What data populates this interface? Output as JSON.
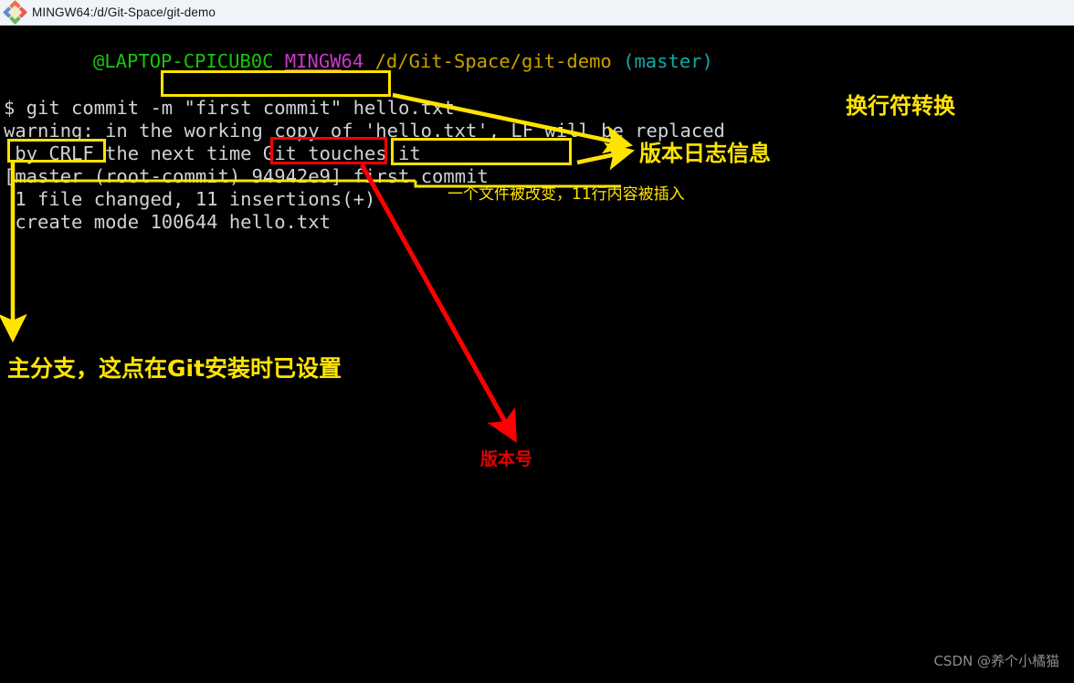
{
  "window": {
    "title": "MINGW64:/d/Git-Space/git-demo",
    "icon": "mingw-diamond-icon"
  },
  "terminal": {
    "prompt": {
      "user_host": "@LAPTOP-CPICUB0C",
      "shell": "MINGW",
      "shell_bits": "64",
      "path": "/d/Git-Space/git-demo",
      "branch": "(master)"
    },
    "lines": [
      {
        "id": "command",
        "text": "$ git commit -m \"first commit\" hello.txt"
      },
      {
        "id": "warning1",
        "text": "warning: in the working copy of 'hello.txt', LF will be replaced"
      },
      {
        "id": "warning2",
        "text": " by CRLF the next time Git touches it"
      },
      {
        "id": "commit",
        "text": "[master (root-commit) 94942e9] first commit"
      },
      {
        "id": "stat",
        "text": " 1 file changed, 11 insertions(+)"
      },
      {
        "id": "create",
        "text": " create mode 100644 hello.txt"
      }
    ],
    "parts": {
      "cmd_prefix": "$ git commit ",
      "cmd_flag": "-m \"first commit\"",
      "cmd_suffix": " hello.txt",
      "commit_open": "[",
      "commit_branch": "master",
      "commit_mid": " (root-commit) ",
      "commit_hash": "94942e9",
      "commit_close": "] ",
      "commit_msg": "first commit"
    }
  },
  "annotations": {
    "crlf_note": "换行符转换",
    "commit_log_note": "版本日志信息",
    "stat_note": "一个文件被改变，11行内容被插入",
    "branch_note": "主分支，这点在Git安装时已设置",
    "hash_note": "版本号"
  },
  "watermark": {
    "text": "CSDN @养个小橘猫"
  },
  "colors": {
    "annotation_yellow": "#ffe400",
    "annotation_red": "#e60000",
    "terminal_bg": "#000000",
    "terminal_fg": "#cfd2d6",
    "prompt_green": "#16c60c",
    "prompt_magenta": "#c838c8",
    "prompt_yellow": "#c8a000",
    "prompt_cyan": "#13a8a8"
  }
}
